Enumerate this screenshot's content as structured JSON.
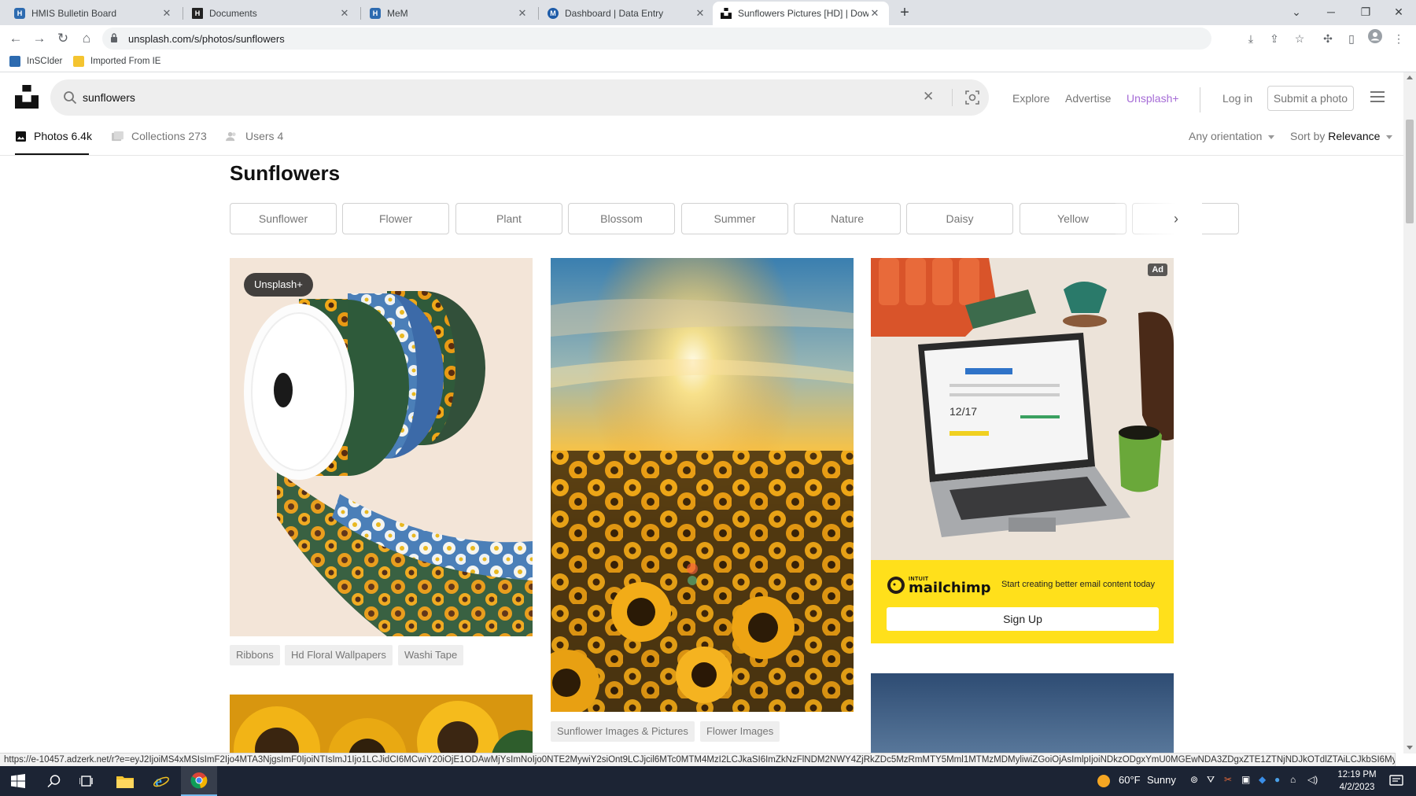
{
  "browser": {
    "tabs": [
      {
        "title": "HMIS Bulletin Board",
        "icon": "hmis-favicon",
        "active": false
      },
      {
        "title": "Documents",
        "icon": "h-favicon",
        "active": false
      },
      {
        "title": "MeM",
        "icon": "hmis-favicon",
        "active": false
      },
      {
        "title": "Dashboard | Data Entry",
        "icon": "m-favicon",
        "active": false
      },
      {
        "title": "Sunflowers Pictures [HD] | Downl",
        "icon": "unsplash-favicon",
        "active": true
      }
    ],
    "url": "unsplash.com/s/photos/sunflowers",
    "bookmarks": [
      {
        "label": "InSCIder",
        "icon": "hmis-favicon"
      },
      {
        "label": "Imported From IE",
        "icon": "folder-icon"
      }
    ],
    "status_url": "https://e-10457.adzerk.net/r?e=eyJ2IjoiMS4xMSIsImF2Ijo4MTA3NjgsImF0IjoiNTIsImJ1Ijo1LCJidCI6MCwiY20iOjE1ODAwMjYsImNoIjo0NTE2MywiY2siOnt9LCJjcil6MTc0MTM4MzI2LCJkaSI6ImZkNzFlNDM2NWY4ZjRkZDc5MzRmMTY5Mml1MTMzMDMyliwiZGoiOjAsImlpIjoiNDkzODgxYmU0MGEwNDA3ZDgxZTE1ZTNjNDJkOTdlZTAiLCJkbSI6MywiZmMiOjM1NDI4ODQ1Mi..."
  },
  "site": {
    "search": {
      "value": "sunflowers"
    },
    "nav": {
      "explore": "Explore",
      "advertise": "Advertise",
      "plus": "Unsplash+",
      "login": "Log in",
      "submit": "Submit a photo"
    },
    "filters": {
      "photos": {
        "label": "Photos",
        "count": "6.4k"
      },
      "collections": {
        "label": "Collections",
        "count": "273"
      },
      "users": {
        "label": "Users",
        "count": "4"
      },
      "orientation": "Any orientation",
      "sort_prefix": "Sort by",
      "sort_value": "Relevance"
    },
    "heading": "Sunflowers",
    "related": [
      "Sunflower",
      "Flower",
      "Plant",
      "Blossom",
      "Summer",
      "Nature",
      "Daisy",
      "Yellow"
    ]
  },
  "photos": {
    "ribbon": {
      "badge": "Unsplash+",
      "tags": [
        "Ribbons",
        "Hd Floral Wallpapers",
        "Washi Tape"
      ]
    },
    "field": {
      "tags": [
        "Sunflower Images & Pictures",
        "Flower Images"
      ]
    },
    "ad": {
      "badge": "Ad",
      "logo_small": "INTUIT",
      "logo_big": "mailchimp",
      "tagline": "Start creating better email content today",
      "button": "Sign Up",
      "screen_date": "12/17"
    }
  },
  "taskbar": {
    "weather_temp": "60°F",
    "weather_text": "Sunny",
    "time": "12:19 PM",
    "date": "4/2/2023"
  },
  "colors": {
    "unsplash_plus": "#a56bd6",
    "mailchimp_yellow": "#ffe01b",
    "taskbar": "#1c2434"
  }
}
